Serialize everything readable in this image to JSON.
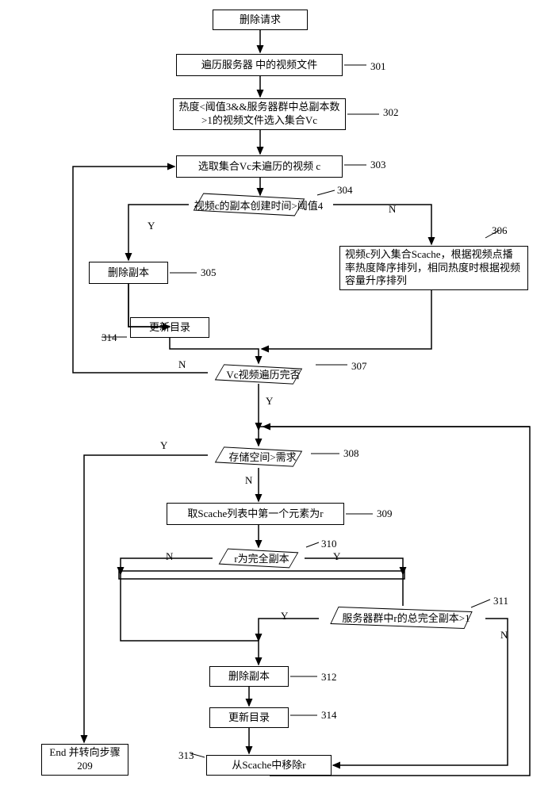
{
  "nodes": {
    "start": "删除请求",
    "n301": "遍历服务器 中的视频文件",
    "n302": "热度<阈值3&&服务器群中总副本数>1的视频文件选入集合Vc",
    "n303": "选取集合Vc未遍历的视频 c",
    "n304": "视频c的副本创建时间>阈值4",
    "n305": "删除副本",
    "n306": "视频c列入集合Scache，根据视频点播率热度降序排列，相同热度时根据视频容量升序排列",
    "n307": "Vc视频遍历完否",
    "n308": "存储空间>需求",
    "n309": "取Scache列表中第一个元素为r",
    "n310": "r为完全副本",
    "n311": "服务器群中r的总完全副本>1",
    "n312": "删除副本",
    "n313": "从Scache中移除r",
    "n314a": "更新目录",
    "n314b": "更新目录",
    "end": "End  并转向步骤209"
  },
  "labels": {
    "l301": "301",
    "l302": "302",
    "l303": "303",
    "l304": "304",
    "l305": "305",
    "l306": "306",
    "l307": "307",
    "l308": "308",
    "l309": "309",
    "l310": "310",
    "l311": "311",
    "l312": "312",
    "l313": "313",
    "l314a": "314",
    "l314b": "314"
  },
  "yn": {
    "Y": "Y",
    "N": "N"
  }
}
